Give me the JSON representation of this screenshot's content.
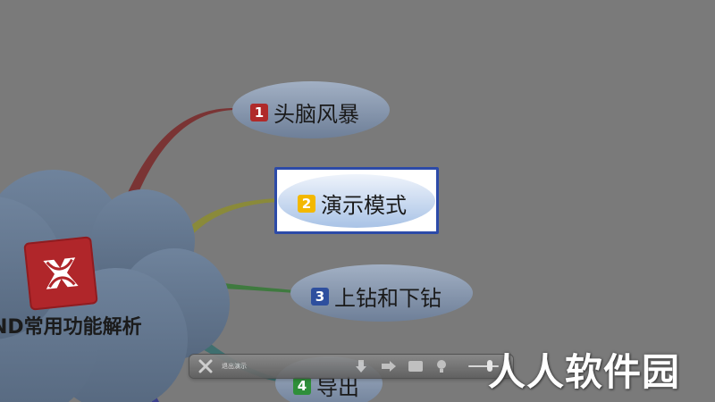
{
  "mindmap": {
    "central_topic": "ND常用功能解析",
    "topics": [
      {
        "number": "1",
        "label": "头脑风暴",
        "badge_color": "#b02a2a"
      },
      {
        "number": "2",
        "label": "演示模式",
        "badge_color": "#f3b800"
      },
      {
        "number": "3",
        "label": "上钻和下钻",
        "badge_color": "#2e4f9e"
      },
      {
        "number": "4",
        "label": "导出",
        "badge_color": "#2f8f3a"
      }
    ],
    "selected_topic": "2"
  },
  "toolbar": {
    "exit_label": "退出演示",
    "icons": [
      "close-icon",
      "arrow-down-icon",
      "arrow-right-icon",
      "rectangle-icon",
      "lightbulb-icon"
    ],
    "zoom_level": 0.6
  },
  "watermark": "人人软件园",
  "colors": {
    "background": "#7a7a7a",
    "branch_1": "#7a3434",
    "branch_2": "#8a8a3a",
    "branch_3": "#3f7a3f",
    "branch_4": "#4a5a7a",
    "bubble": "#8f9fb5",
    "selected_border": "#2c4aa8"
  }
}
